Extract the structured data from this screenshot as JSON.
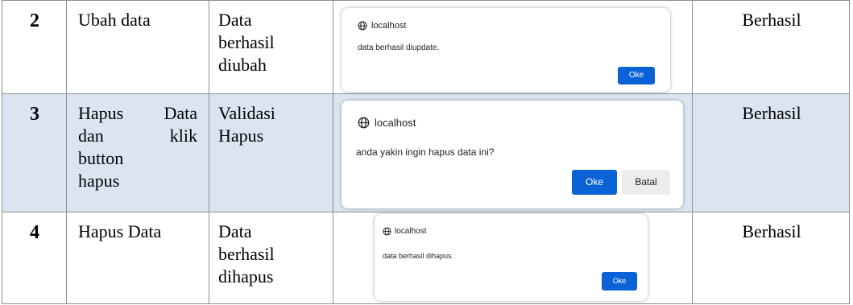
{
  "rows": [
    {
      "no": "2",
      "step_lines": [
        "Ubah data"
      ],
      "expected_lines": [
        "Data",
        "berhasil",
        "diubah"
      ],
      "dialog": {
        "origin": "localhost",
        "message": "data berhasil diupdate.",
        "ok_label": "Oke"
      },
      "result": "Berhasil"
    },
    {
      "no": "3",
      "step_lines": [
        [
          "Hapus",
          "Data"
        ],
        [
          "dan",
          "klik"
        ],
        "button",
        "hapus"
      ],
      "expected_lines": [
        "Validasi",
        "Hapus"
      ],
      "dialog": {
        "origin": "localhost",
        "message": "anda yakin ingin hapus data ini?",
        "ok_label": "Oke",
        "cancel_label": "Batal"
      },
      "result": "Berhasil"
    },
    {
      "no": "4",
      "step_lines": [
        "Hapus Data"
      ],
      "expected_lines": [
        "Data",
        "berhasil",
        "dihapus"
      ],
      "dialog": {
        "origin": "localhost",
        "message": "data berhasil dihapus.",
        "ok_label": "Oke"
      },
      "result": "Berhasil"
    }
  ],
  "colors": {
    "shaded_row": "#dbe5f1",
    "primary_button": "#0b62d6",
    "secondary_button": "#ececec",
    "border": "#8f8f8f"
  },
  "icons": {
    "dialog_origin": "globe-icon"
  }
}
